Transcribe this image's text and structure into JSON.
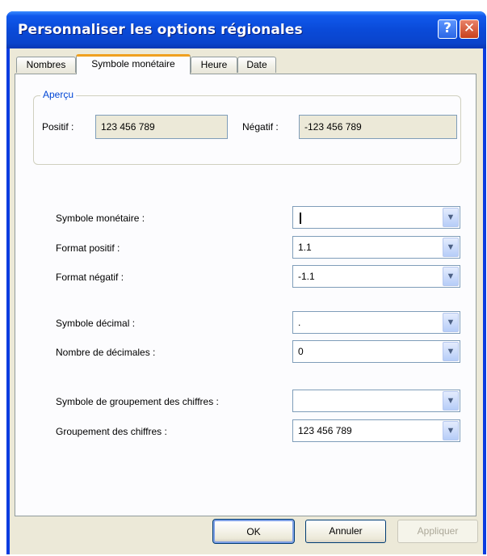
{
  "window": {
    "title": "Personnaliser les options régionales"
  },
  "tabs": [
    {
      "label": "Nombres"
    },
    {
      "label": "Symbole monétaire"
    },
    {
      "label": "Heure"
    },
    {
      "label": "Date"
    }
  ],
  "preview": {
    "legend": "Aperçu",
    "positive_label": "Positif :",
    "positive_value": "123 456 789",
    "negative_label": "Négatif :",
    "negative_value": "-123 456 789"
  },
  "fields": {
    "currency_symbol": {
      "label": "Symbole monétaire :",
      "value": ""
    },
    "positive_format": {
      "label": "Format positif :",
      "value": "1.1"
    },
    "negative_format": {
      "label": "Format négatif :",
      "value": "-1.1"
    },
    "decimal_symbol": {
      "label": "Symbole décimal :",
      "value": "."
    },
    "decimal_count": {
      "label": "Nombre de décimales :",
      "value": "0"
    },
    "grouping_symbol": {
      "label": "Symbole de groupement des chiffres :",
      "value": ""
    },
    "digit_grouping": {
      "label": "Groupement des chiffres :",
      "value": "123 456 789"
    }
  },
  "buttons": {
    "ok": "OK",
    "cancel": "Annuler",
    "apply": "Appliquer"
  },
  "icons": {
    "help": "help-icon",
    "close": "close-icon",
    "dropdown": "chevron-down-icon"
  }
}
